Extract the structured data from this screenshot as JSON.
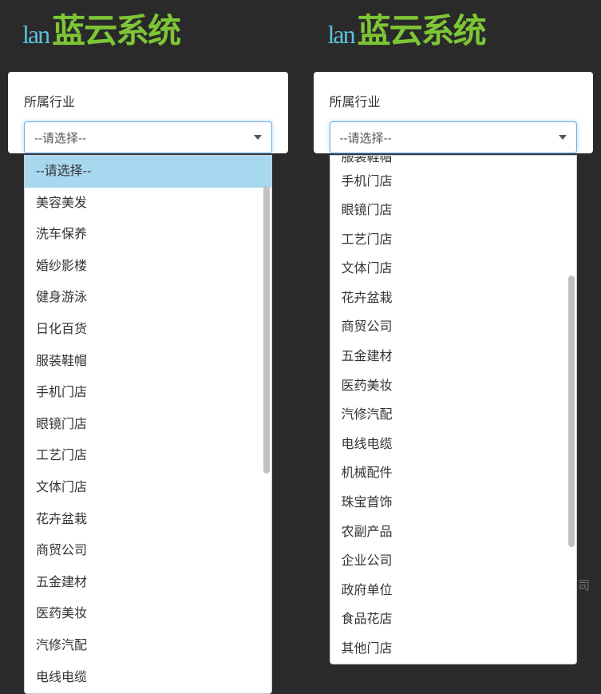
{
  "logo": {
    "prefix": "lan",
    "brand": "蓝云系统"
  },
  "field_label": "所属行业",
  "select_placeholder": "--请选择--",
  "left": {
    "options": [
      {
        "label": "--请选择--",
        "highlight": true
      },
      {
        "label": "美容美发"
      },
      {
        "label": "洗车保养"
      },
      {
        "label": "婚纱影楼"
      },
      {
        "label": "健身游泳"
      },
      {
        "label": "日化百货"
      },
      {
        "label": "服装鞋帽"
      },
      {
        "label": "手机门店"
      },
      {
        "label": "眼镜门店"
      },
      {
        "label": "工艺门店"
      },
      {
        "label": "文体门店"
      },
      {
        "label": "花卉盆栽"
      },
      {
        "label": "商贸公司"
      },
      {
        "label": "五金建材"
      },
      {
        "label": "医药美妆"
      },
      {
        "label": "汽修汽配"
      },
      {
        "label": "电线电缆"
      }
    ]
  },
  "right": {
    "cutoff_label": "服装鞋帽",
    "options": [
      {
        "label": "手机门店"
      },
      {
        "label": "眼镜门店"
      },
      {
        "label": "工艺门店"
      },
      {
        "label": "文体门店"
      },
      {
        "label": "花卉盆栽"
      },
      {
        "label": "商贸公司"
      },
      {
        "label": "五金建材"
      },
      {
        "label": "医药美妆"
      },
      {
        "label": "汽修汽配"
      },
      {
        "label": "电线电缆"
      },
      {
        "label": "机械配件"
      },
      {
        "label": "珠宝首饰"
      },
      {
        "label": "农副产品"
      },
      {
        "label": "企业公司"
      },
      {
        "label": "政府单位"
      },
      {
        "label": "食品花店"
      },
      {
        "label": "其他门店"
      }
    ]
  },
  "watermark": "郑州蓝云科技有限公司"
}
